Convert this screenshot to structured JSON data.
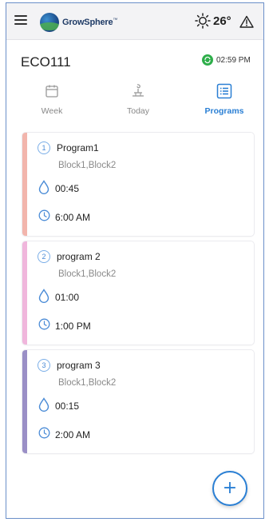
{
  "header": {
    "brand": "GrowSphere",
    "brand_mark": "™",
    "temperature": "26°",
    "menu_icon": "hamburger-menu-icon",
    "weather_icon": "sun-icon",
    "alert_icon": "warning-triangle-icon"
  },
  "device": {
    "name": "ECO111",
    "time": "02:59 PM",
    "status_color": "#2eae4a"
  },
  "tabs": [
    {
      "label": "Week",
      "icon": "calendar-icon",
      "active": false
    },
    {
      "label": "Today",
      "icon": "sprinkler-icon",
      "active": false
    },
    {
      "label": "Programs",
      "icon": "list-icon",
      "active": true
    }
  ],
  "programs": [
    {
      "number": "1",
      "name": "Program1",
      "blocks": "Block1,Block2",
      "duration": "00:45",
      "start": "6:00 AM",
      "color": "#f2b5ac"
    },
    {
      "number": "2",
      "name": "program 2",
      "blocks": "Block1,Block2",
      "duration": "01:00",
      "start": "1:00 PM",
      "color": "#f0b6dc"
    },
    {
      "number": "3",
      "name": "program 3",
      "blocks": "Block1,Block2",
      "duration": "00:15",
      "start": "2:00 AM",
      "color": "#9a8fc6"
    }
  ],
  "fab": {
    "label": "+"
  },
  "colors": {
    "accent": "#2a7fd4",
    "frame": "#6b8fc9"
  }
}
